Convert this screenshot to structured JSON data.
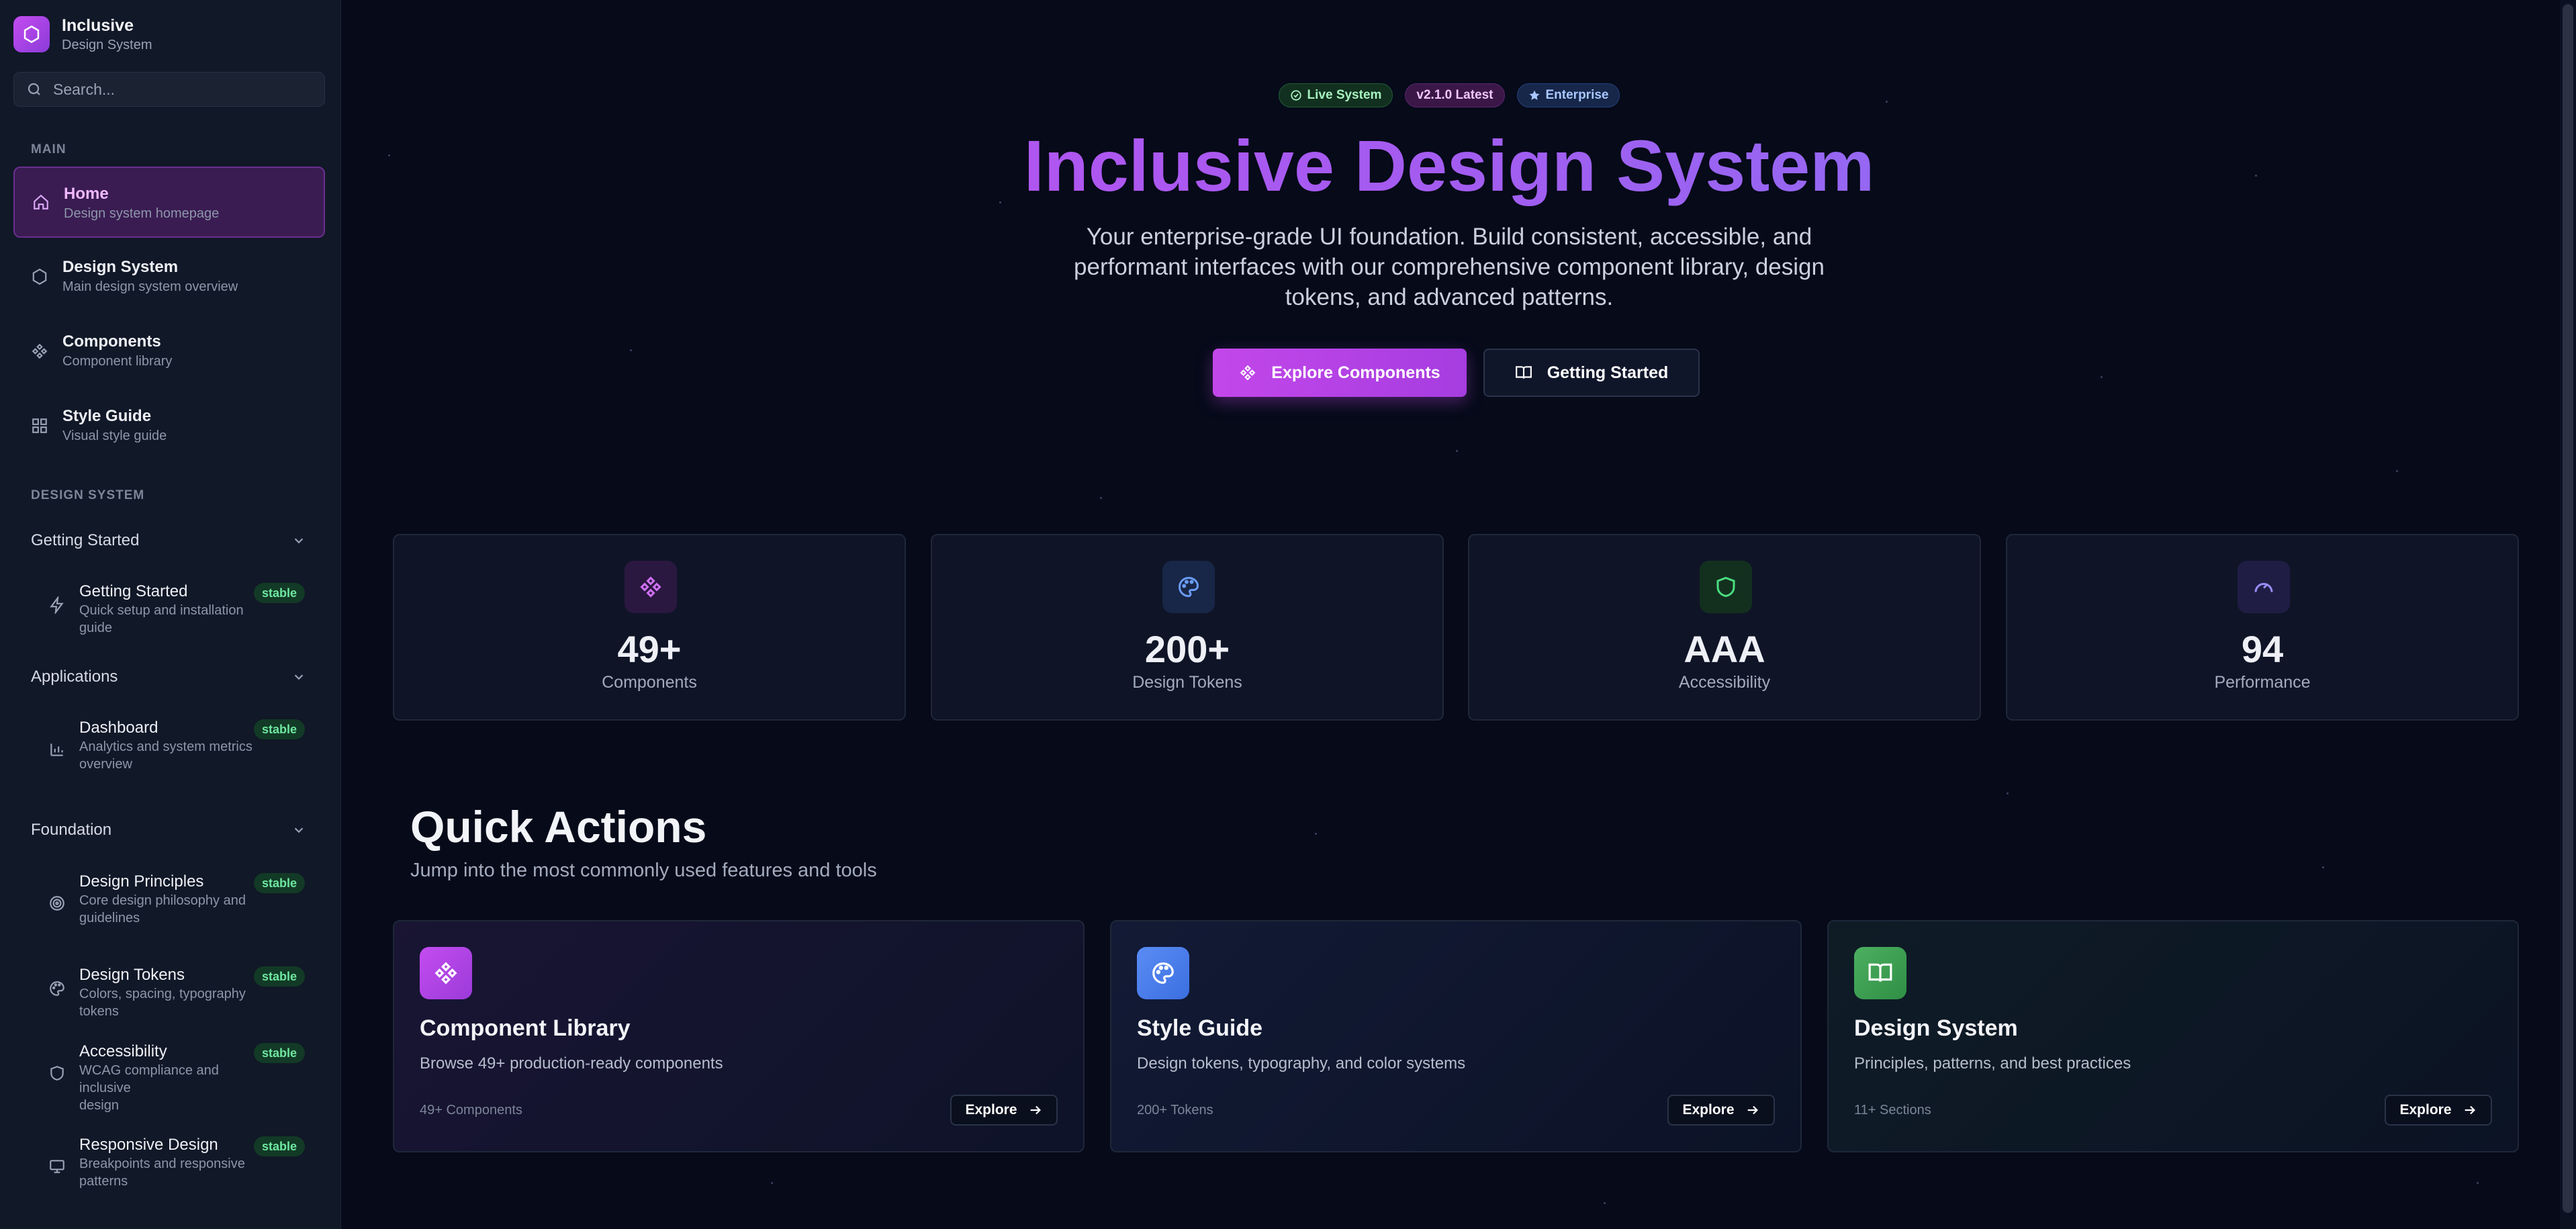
{
  "brand": {
    "title": "Inclusive",
    "subtitle": "Design System"
  },
  "search": {
    "placeholder": "Search..."
  },
  "sidebar": {
    "main_label": "MAIN",
    "main_items": [
      {
        "title": "Home",
        "desc": "Design system homepage",
        "icon": "home-icon",
        "active": true
      },
      {
        "title": "Design System",
        "desc": "Main design system overview",
        "icon": "hexagon-icon"
      },
      {
        "title": "Components",
        "desc": "Component library",
        "icon": "components-icon"
      },
      {
        "title": "Style Guide",
        "desc": "Visual style guide",
        "icon": "grid-icon"
      }
    ],
    "ds_label": "DESIGN SYSTEM",
    "groups": [
      {
        "title": "Getting Started",
        "items": [
          {
            "title": "Getting Started",
            "desc1": "Quick setup and installation guide",
            "desc2": "",
            "badge": "stable",
            "icon": "bolt-icon"
          }
        ]
      },
      {
        "title": "Applications",
        "items": [
          {
            "title": "Dashboard",
            "desc1": "Analytics and system metrics",
            "desc2": "overview",
            "badge": "stable",
            "icon": "bar-chart-icon"
          }
        ]
      },
      {
        "title": "Foundation",
        "items": [
          {
            "title": "Design Principles",
            "desc1": "Core design philosophy and",
            "desc2": "guidelines",
            "badge": "stable",
            "icon": "target-icon"
          },
          {
            "title": "Design Tokens",
            "desc1": "Colors, spacing, typography tokens",
            "desc2": "",
            "badge": "stable",
            "icon": "palette-icon"
          },
          {
            "title": "Accessibility",
            "desc1": "WCAG compliance and inclusive",
            "desc2": "design",
            "badge": "stable",
            "icon": "shield-icon"
          },
          {
            "title": "Responsive Design",
            "desc1": "Breakpoints and responsive",
            "desc2": "patterns",
            "badge": "stable",
            "icon": "monitor-icon"
          }
        ]
      }
    ]
  },
  "hero": {
    "badges": [
      "Live System",
      "v2.1.0 Latest",
      "Enterprise"
    ],
    "title": "Inclusive Design System",
    "subtitle": "Your enterprise-grade UI foundation. Build consistent, accessible, and performant interfaces with our comprehensive component library, design tokens, and advanced patterns.",
    "primary_button": "Explore Components",
    "secondary_button": "Getting Started"
  },
  "stats": [
    {
      "value": "49+",
      "label": "Components",
      "icon": "components-icon",
      "color": "#c44cf0"
    },
    {
      "value": "200+",
      "label": "Design Tokens",
      "icon": "palette-icon",
      "color": "#5b8cf5"
    },
    {
      "value": "AAA",
      "label": "Accessibility",
      "icon": "shield-icon",
      "color": "#4ade80"
    },
    {
      "value": "94",
      "label": "Performance",
      "icon": "gauge-icon",
      "color": "#8b7cf5"
    }
  ],
  "quick_actions": {
    "title": "Quick Actions",
    "subtitle": "Jump into the most commonly used features and tools",
    "cards": [
      {
        "title": "Component Library",
        "desc": "Browse 49+ production-ready components",
        "meta": "49+ Components",
        "button": "Explore",
        "icon": "components-icon"
      },
      {
        "title": "Style Guide",
        "desc": "Design tokens, typography, and color systems",
        "meta": "200+ Tokens",
        "button": "Explore",
        "icon": "palette-icon"
      },
      {
        "title": "Design System",
        "desc": "Principles, patterns, and best practices",
        "meta": "11+ Sections",
        "button": "Explore",
        "icon": "book-icon"
      }
    ]
  },
  "colors": {
    "accent": "#c44cf0",
    "background": "#060a19",
    "sidebar": "#111827",
    "stable_badge": "#6ee7a0"
  }
}
